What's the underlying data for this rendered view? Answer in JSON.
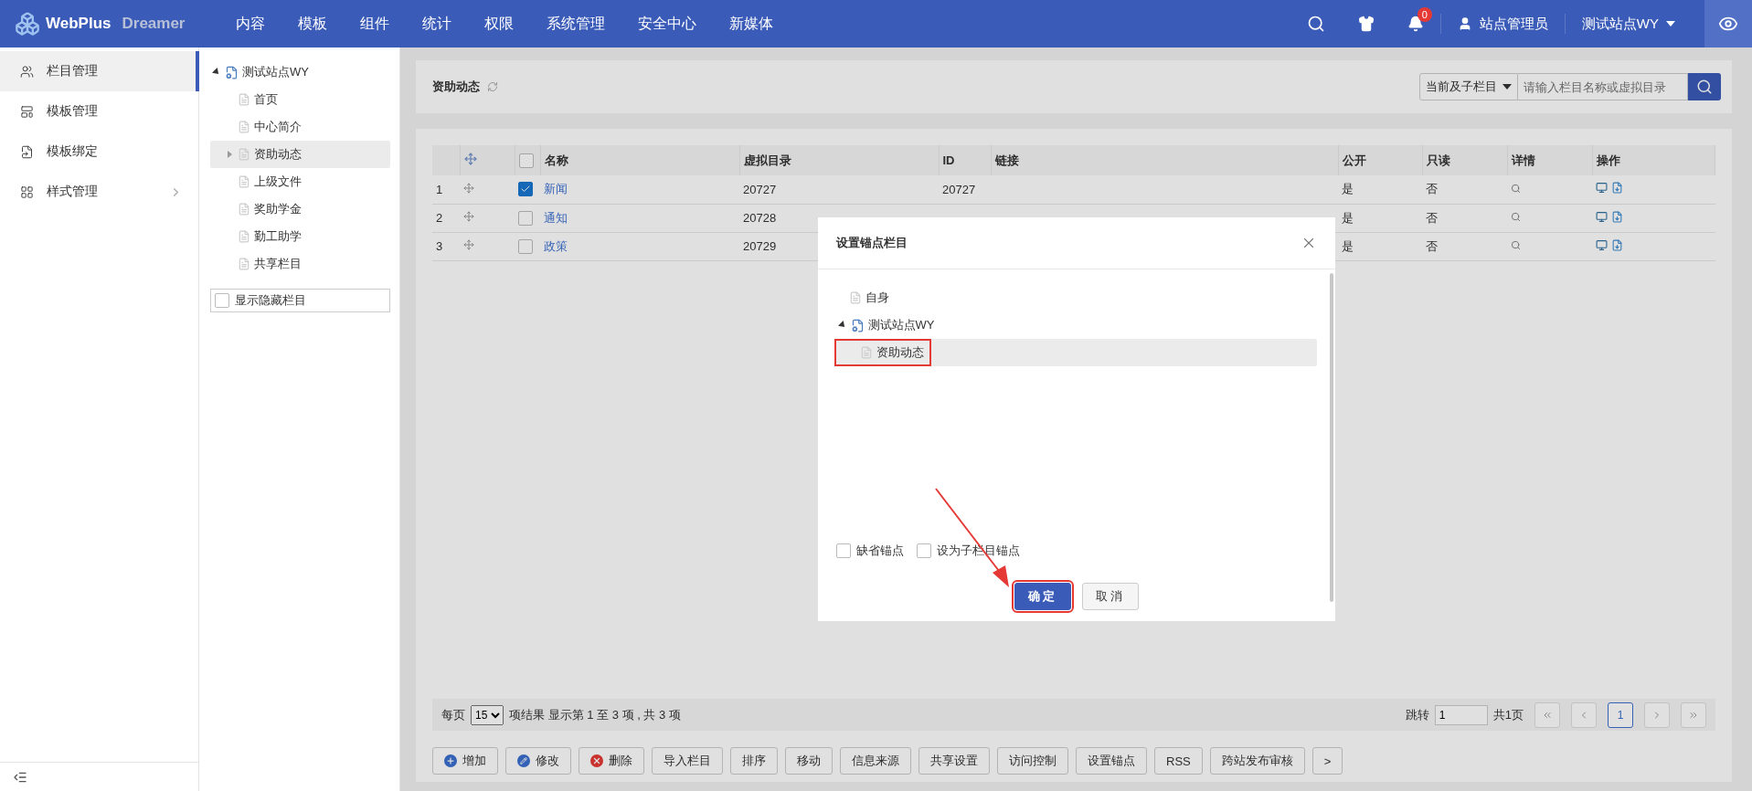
{
  "topbar": {
    "logo": "WebPlus",
    "logo_sub": "Dreamer",
    "nav": [
      "内容",
      "模板",
      "组件",
      "统计",
      "权限",
      "系统管理",
      "安全中心",
      "新媒体"
    ],
    "notifications": "0",
    "user": "站点管理员",
    "site": "测试站点WY"
  },
  "sidebar": {
    "items": [
      {
        "label": "栏目管理",
        "selected": true,
        "expandable": false
      },
      {
        "label": "模板管理",
        "selected": false,
        "expandable": false
      },
      {
        "label": "模板绑定",
        "selected": false,
        "expandable": false
      },
      {
        "label": "样式管理",
        "selected": false,
        "expandable": true
      }
    ]
  },
  "tree": {
    "root": {
      "label": "测试站点WY",
      "expanded": true,
      "children": [
        {
          "label": "首页",
          "selected": false,
          "expandable": false
        },
        {
          "label": "中心简介",
          "selected": false,
          "expandable": false
        },
        {
          "label": "资助动态",
          "selected": true,
          "expandable": true
        },
        {
          "label": "上级文件",
          "selected": false,
          "expandable": false
        },
        {
          "label": "奖助学金",
          "selected": false,
          "expandable": false
        },
        {
          "label": "勤工助学",
          "selected": false,
          "expandable": false
        },
        {
          "label": "共享栏目",
          "selected": false,
          "expandable": false
        }
      ]
    },
    "show_hidden": {
      "label": "显示隐藏栏目",
      "checked": false
    }
  },
  "header": {
    "title": "资助动态",
    "scope_select": "当前及子栏目",
    "search_placeholder": "请输入栏目名称或虚拟目录"
  },
  "table": {
    "select_all": {
      "checked": false
    },
    "columns": [
      "名称",
      "虚拟目录",
      "ID",
      "链接",
      "公开",
      "只读",
      "详情",
      "操作"
    ],
    "rows": [
      {
        "index": "1",
        "checked": true,
        "name": "新闻",
        "dir": "20727",
        "id": "20727",
        "public": "是",
        "readonly": "否"
      },
      {
        "index": "2",
        "checked": false,
        "name": "通知",
        "dir": "20728",
        "public": "是",
        "readonly": "否"
      },
      {
        "index": "3",
        "checked": false,
        "name": "政策",
        "dir": "20729",
        "public": "是",
        "readonly": "否"
      }
    ]
  },
  "pagination": {
    "per_page_label": "每页",
    "per_page": "15",
    "summary": "项结果 显示第 1 至 3 项 , 共 3 项",
    "jump_label": "跳转",
    "jump_value": "1",
    "total_pages": "共1页",
    "pages": [
      {
        "label": "1",
        "selected": true
      }
    ]
  },
  "toolbar": [
    {
      "label": "增加",
      "kind": "add"
    },
    {
      "label": "修改",
      "kind": "edit"
    },
    {
      "label": "删除",
      "kind": "delete"
    },
    {
      "label": "导入栏目",
      "kind": "plain"
    },
    {
      "label": "排序",
      "kind": "plain"
    },
    {
      "label": "移动",
      "kind": "plain"
    },
    {
      "label": "信息来源",
      "kind": "plain"
    },
    {
      "label": "共享设置",
      "kind": "plain"
    },
    {
      "label": "访问控制",
      "kind": "plain"
    },
    {
      "label": "设置锚点",
      "kind": "plain"
    },
    {
      "label": "RSS",
      "kind": "plain"
    },
    {
      "label": "跨站发布审核",
      "kind": "plain"
    },
    {
      "label": ">",
      "kind": "plain"
    }
  ],
  "dialog": {
    "title": "设置锚点栏目",
    "tree": [
      {
        "label": "自身",
        "kind": "leaf"
      },
      {
        "label": "测试站点WY",
        "kind": "site",
        "expanded": true,
        "children": [
          {
            "label": "资助动态",
            "selected": true,
            "highlighted": true
          }
        ]
      }
    ],
    "options": [
      {
        "label": "缺省锚点",
        "checked": false
      },
      {
        "label": "设为子栏目锚点",
        "checked": false
      }
    ],
    "buttons": [
      {
        "label": "确定",
        "kind": "primary",
        "highlighted": true
      },
      {
        "label": "取消",
        "kind": "secondary",
        "highlighted": false
      }
    ]
  }
}
